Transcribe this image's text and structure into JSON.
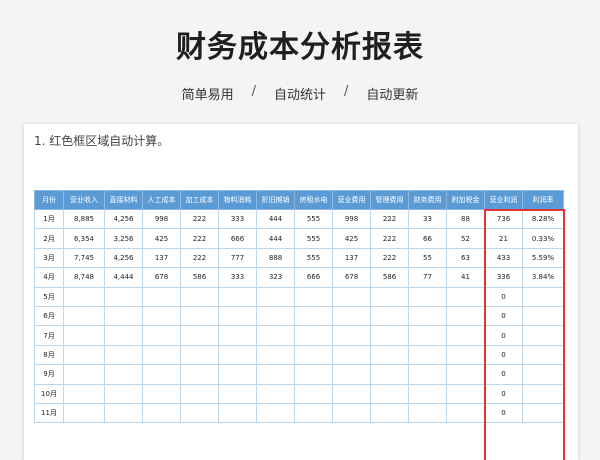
{
  "title": "财务成本分析报表",
  "subtitle": [
    "简单易用",
    "自动统计",
    "自动更新"
  ],
  "separator": "/",
  "note": "1. 红色框区域自动计算。",
  "highlight_color": "#e0343a",
  "header_color": "#5b9bd5",
  "table": {
    "headers": [
      "月份",
      "营业收入",
      "直接材料",
      "人工成本",
      "加工成本",
      "物料消耗",
      "折旧摊销",
      "房租水电",
      "营业费用",
      "管理费用",
      "财务费用",
      "附加税金",
      "营业利润",
      "利润率"
    ],
    "rows": [
      [
        "1月",
        "8,885",
        "4,256",
        "998",
        "222",
        "333",
        "444",
        "555",
        "998",
        "222",
        "33",
        "88",
        "736",
        "8.28%"
      ],
      [
        "2月",
        "6,354",
        "3,256",
        "425",
        "222",
        "666",
        "444",
        "555",
        "425",
        "222",
        "66",
        "52",
        "21",
        "0.33%"
      ],
      [
        "3月",
        "7,745",
        "4,256",
        "137",
        "222",
        "777",
        "888",
        "555",
        "137",
        "222",
        "55",
        "63",
        "433",
        "5.59%"
      ],
      [
        "4月",
        "8,748",
        "4,444",
        "678",
        "586",
        "333",
        "323",
        "666",
        "678",
        "586",
        "77",
        "41",
        "336",
        "3.84%"
      ],
      [
        "5月",
        "",
        "",
        "",
        "",
        "",
        "",
        "",
        "",
        "",
        "",
        "",
        "0",
        ""
      ],
      [
        "6月",
        "",
        "",
        "",
        "",
        "",
        "",
        "",
        "",
        "",
        "",
        "",
        "0",
        ""
      ],
      [
        "7月",
        "",
        "",
        "",
        "",
        "",
        "",
        "",
        "",
        "",
        "",
        "",
        "0",
        ""
      ],
      [
        "8月",
        "",
        "",
        "",
        "",
        "",
        "",
        "",
        "",
        "",
        "",
        "",
        "0",
        ""
      ],
      [
        "9月",
        "",
        "",
        "",
        "",
        "",
        "",
        "",
        "",
        "",
        "",
        "",
        "0",
        ""
      ],
      [
        "10月",
        "",
        "",
        "",
        "",
        "",
        "",
        "",
        "",
        "",
        "",
        "",
        "0",
        ""
      ],
      [
        "11月",
        "",
        "",
        "",
        "",
        "",
        "",
        "",
        "",
        "",
        "",
        "",
        "0",
        ""
      ]
    ]
  }
}
